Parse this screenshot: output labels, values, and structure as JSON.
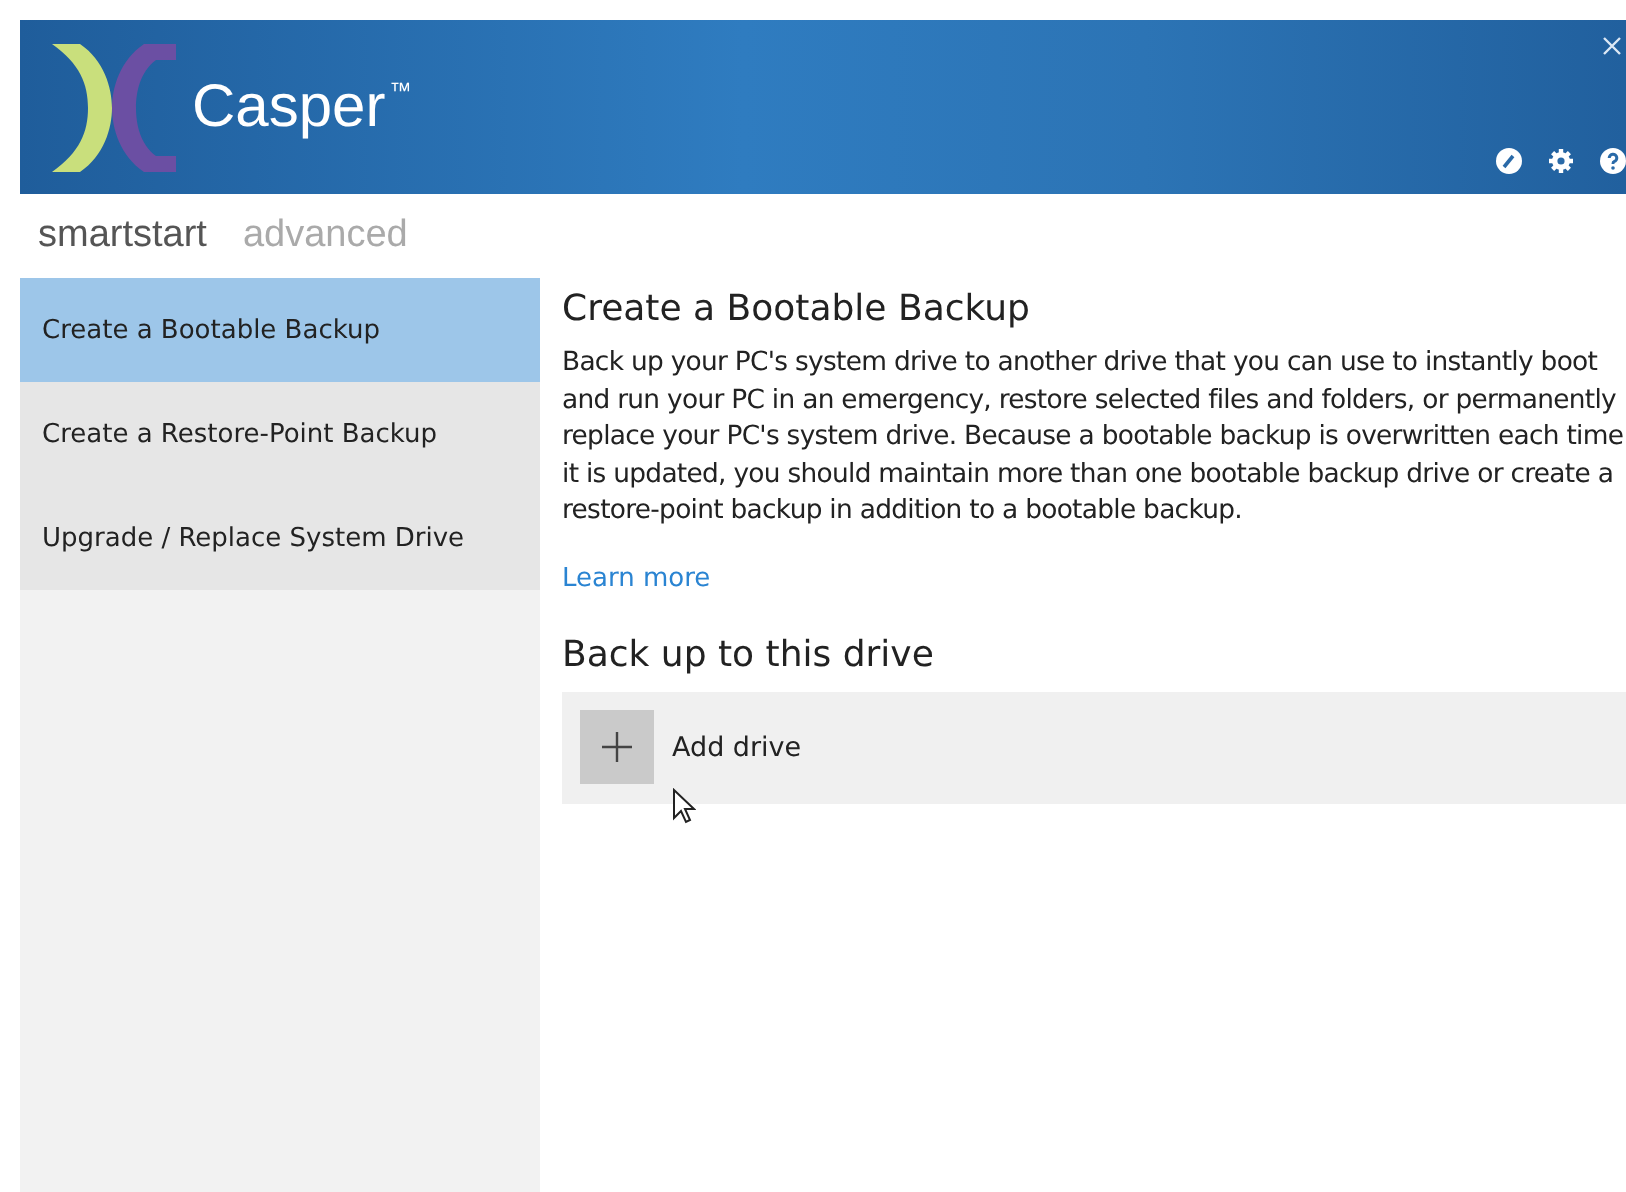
{
  "window": {
    "title": "Casper$^{™}$"
  },
  "tabs": [
    {
      "label": "smartstart",
      "selected": true
    },
    {
      "label": "advanced",
      "selected": false
    }
  ],
  "sidebar": {
    "items": [
      {
        "label": "Create a Bootable Backup",
        "selected": true
      },
      {
        "label": "Create a Restore-Point Backup",
        "selected": false
      },
      {
        "label": "Upgrade / Replace System Drive",
        "selected": false
      }
    ]
  },
  "content": {
    "heading": "Create a Bootable Backup",
    "description": "Back up your PC's system drive to another drive that you can use to instantly boot and run your PC in an emergency, restore selected files and folders, or permanently replace your PC's system drive. Because a bootable backup is overwritten each time it is updated, you should maintain more than one bootable backup drive or create a restore-point backup in addition to a bootable backup.",
    "link": "Learn more",
    "section_heading": "Back up to this drive",
    "add_button": "Add drive"
  }
}
